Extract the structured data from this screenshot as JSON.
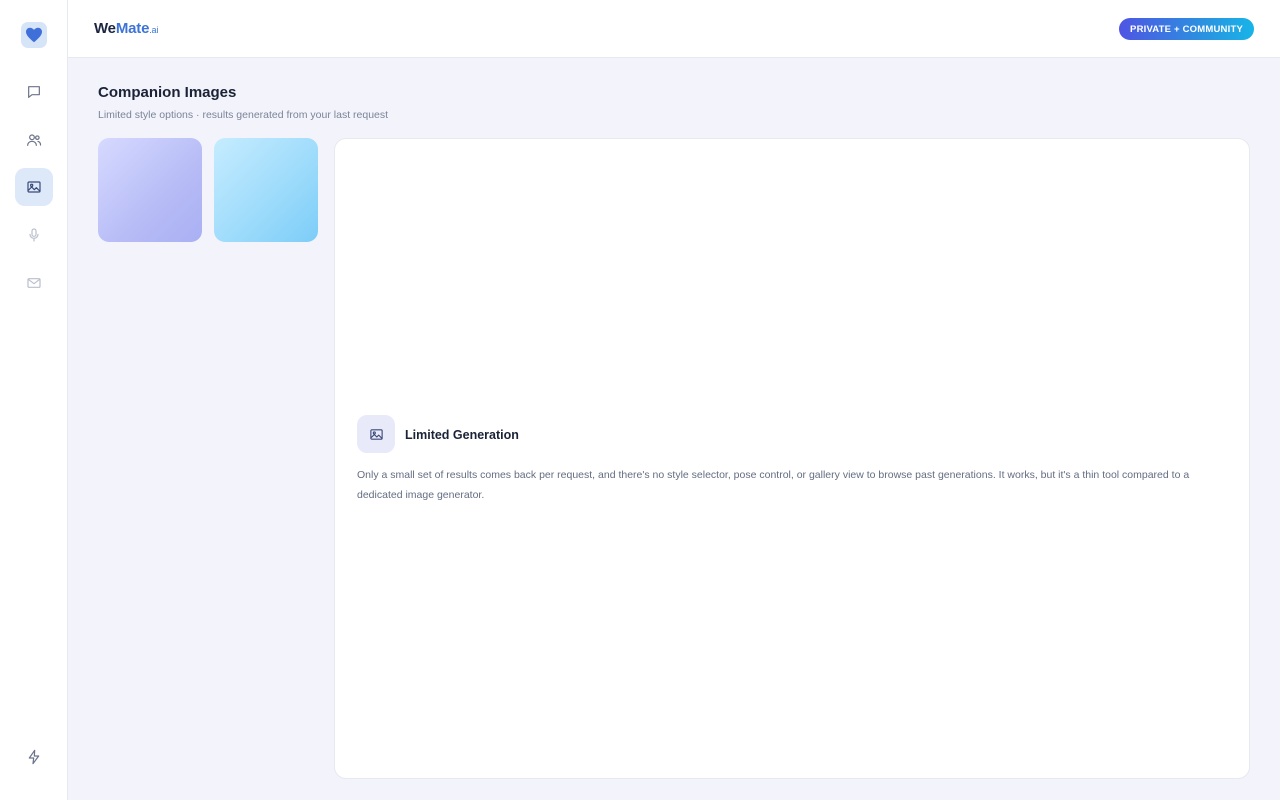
{
  "brand": {
    "part1": "We",
    "part2": "Mate",
    "part3": ".ai"
  },
  "header": {
    "badge_label": "PRIVATE + COMMUNITY"
  },
  "sidebar": {
    "items": [
      {
        "icon": "chat-icon",
        "active": false
      },
      {
        "icon": "users-icon",
        "active": false
      },
      {
        "icon": "image-icon",
        "active": true
      },
      {
        "icon": "microphone-icon",
        "active": false
      },
      {
        "icon": "mail-icon",
        "active": false
      }
    ],
    "bottom_icon": "lightning-icon"
  },
  "main": {
    "title": "Companion Images",
    "subtitle": "Limited style options · results generated from your last request",
    "thumbnails": [
      {
        "colors": [
          "#d6daff",
          "#a9b0f3"
        ]
      },
      {
        "colors": [
          "#c6ecff",
          "#7ccdf8"
        ]
      }
    ],
    "notice": {
      "icon": "image-icon",
      "title": "Limited Generation",
      "text": "Only a small set of results comes back per request, and there's no style selector, pose control, or gallery view to browse past generations. It works, but it's a thin tool compared to a dedicated image generator."
    }
  },
  "colors": {
    "accent": "#3e74d6",
    "badge_gradient_start": "#4f55e3",
    "badge_gradient_end": "#18b4e8",
    "background": "#f3f4fb"
  }
}
